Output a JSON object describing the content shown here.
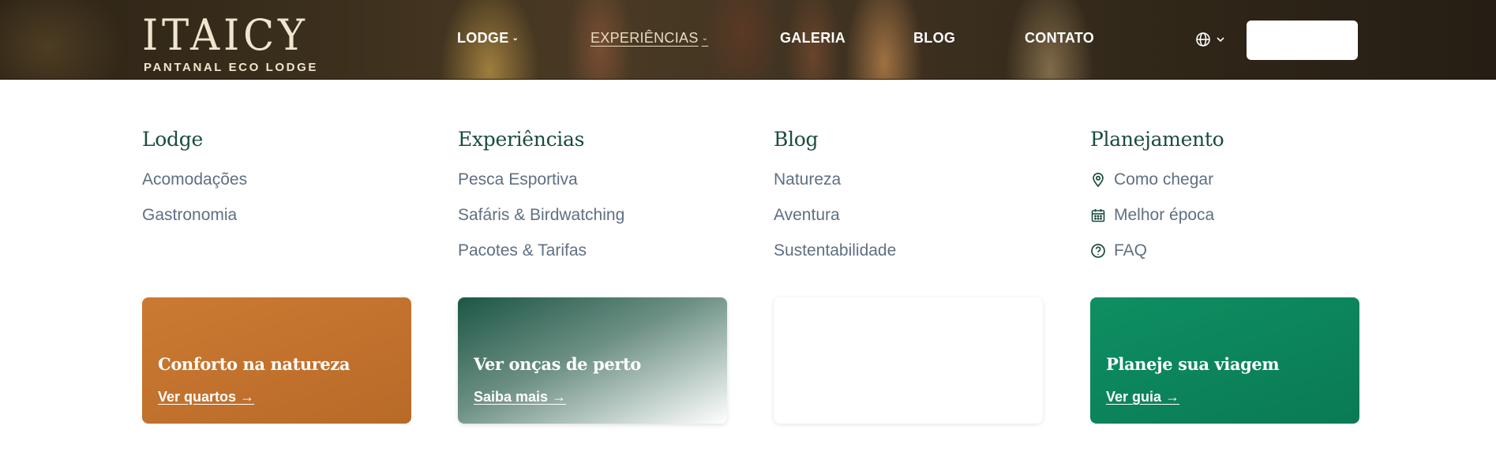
{
  "header": {
    "logo": {
      "main": "ITAICY",
      "sub": "PANTANAL ECO LODGE"
    },
    "nav": [
      {
        "label": "LODGE",
        "has_dropdown": true,
        "active": false
      },
      {
        "label": "EXPERIÊNCIAS",
        "has_dropdown": true,
        "active": true
      },
      {
        "label": "GALERIA",
        "has_dropdown": false,
        "active": false
      },
      {
        "label": "BLOG",
        "has_dropdown": false,
        "active": false
      },
      {
        "label": "CONTATO",
        "has_dropdown": false,
        "active": false
      }
    ],
    "language_icon": "globe-icon",
    "dropdown_glyph": "⌄"
  },
  "mega_menu": {
    "columns": [
      {
        "title": "Lodge",
        "links": [
          "Acomodações",
          "Gastronomia"
        ]
      },
      {
        "title": "Experiências",
        "links": [
          "Pesca Esportiva",
          "Safáris & Birdwatching",
          "Pacotes & Tarifas"
        ]
      },
      {
        "title": "Blog",
        "links": [
          "Natureza",
          "Aventura",
          "Sustentabilidade"
        ]
      },
      {
        "title": "Planejamento",
        "links": [
          {
            "label": "Como chegar",
            "icon": "map-pin-icon"
          },
          {
            "label": "Melhor época",
            "icon": "calendar-icon"
          },
          {
            "label": "FAQ",
            "icon": "help-circle-icon"
          }
        ]
      }
    ],
    "cards": [
      {
        "title": "Conforto na natureza",
        "link": "Ver quartos →"
      },
      {
        "title": "Ver onças de perto",
        "link": "Saiba mais →"
      },
      {
        "title": "",
        "link": ""
      },
      {
        "title": "Planeje sua viagem",
        "link": "Ver guia →"
      }
    ]
  },
  "colors": {
    "heading_green": "#1a4d3a",
    "link_gray": "#5f6f83",
    "card_orange": "#c27330",
    "card_green": "#0a8459"
  }
}
